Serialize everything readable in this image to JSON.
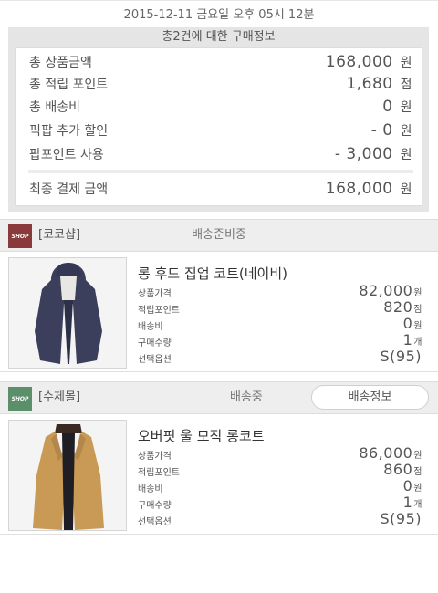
{
  "order_datetime": "2015-12-11 금요일 오후 05시 12분",
  "summary": {
    "title": "총2건에 대한 구매정보",
    "rows": [
      {
        "label": "총 상품금액",
        "value": "168,000",
        "unit": "원"
      },
      {
        "label": "총 적립 포인트",
        "value": "1,680",
        "unit": "점"
      },
      {
        "label": "총 배송비",
        "value": "0",
        "unit": "원"
      },
      {
        "label": "픽팝 추가 할인",
        "value": "- 0",
        "unit": "원"
      },
      {
        "label": "팝포인트 사용",
        "value": "- 3,000",
        "unit": "원"
      }
    ],
    "final": {
      "label": "최종 결제 금액",
      "value": "168,000",
      "unit": "원"
    }
  },
  "shops": [
    {
      "logo_text": "SHOP",
      "name": "[코코샵]",
      "status": "배송준비중",
      "product": {
        "name": "롱 후드 집업 코트(네이비)",
        "details": [
          {
            "label": "상품가격",
            "value": "82,000",
            "unit": "원"
          },
          {
            "label": "적립포인트",
            "value": "820",
            "unit": "점"
          },
          {
            "label": "배송비",
            "value": "0",
            "unit": "원"
          },
          {
            "label": "구매수량",
            "value": "1",
            "unit": "개"
          },
          {
            "label": "선택옵션",
            "value": "S(95)",
            "unit": ""
          }
        ]
      }
    },
    {
      "logo_text": "SHOP",
      "name": "[수제몰]",
      "status": "배송중",
      "track_button": "배송정보",
      "product": {
        "name": "오버핏 울 모직 롱코트",
        "details": [
          {
            "label": "상품가격",
            "value": "86,000",
            "unit": "원"
          },
          {
            "label": "적립포인트",
            "value": "860",
            "unit": "점"
          },
          {
            "label": "배송비",
            "value": "0",
            "unit": "원"
          },
          {
            "label": "구매수량",
            "value": "1",
            "unit": "개"
          },
          {
            "label": "선택옵션",
            "value": "S(95)",
            "unit": ""
          }
        ]
      }
    }
  ],
  "colors": {
    "summary_bg": "#e5e5e5",
    "shop_header_bg": "#eeeeee",
    "navy_coat": "#3b3f5c",
    "camel_coat": "#c99a55"
  }
}
